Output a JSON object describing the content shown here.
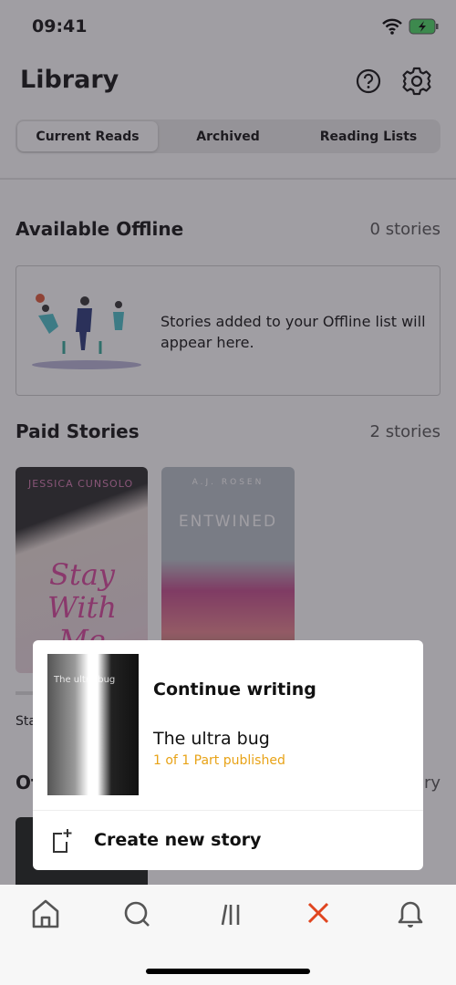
{
  "status_bar": {
    "time": "09:41",
    "wifi_icon": "wifi-icon",
    "battery_icon": "battery-charging-icon",
    "battery_color": "#4cd964"
  },
  "header": {
    "title": "Library",
    "help_icon": "help-icon",
    "settings_icon": "gear-icon"
  },
  "tabs": [
    {
      "label": "Current Reads",
      "selected": true
    },
    {
      "label": "Archived",
      "selected": false
    },
    {
      "label": "Reading Lists",
      "selected": false
    }
  ],
  "offline": {
    "title": "Available Offline",
    "count": "0 stories",
    "empty_text": "Stories added to your Offline list will appear here."
  },
  "paid": {
    "title": "Paid Stories",
    "count": "2 stories",
    "covers": [
      {
        "author": "JESSICA CUNSOLO",
        "title": "Stay With Me"
      },
      {
        "author": "A.J. ROSEN",
        "title": "ENTWINED"
      }
    ],
    "partial_label": "Sta"
  },
  "other": {
    "title_partial": "Ot",
    "count_partial": "ry"
  },
  "popup": {
    "continue_label": "Continue writing",
    "story_title": "The ultra bug",
    "cover_text": "The ultra bug",
    "status": "1 of 1 Part published",
    "status_color": "#e8a317",
    "create_label": "Create new story"
  },
  "tab_bar": {
    "items": [
      "home-icon",
      "search-icon",
      "library-icon",
      "close-icon",
      "bell-icon"
    ],
    "active_color": "#e0451f"
  }
}
